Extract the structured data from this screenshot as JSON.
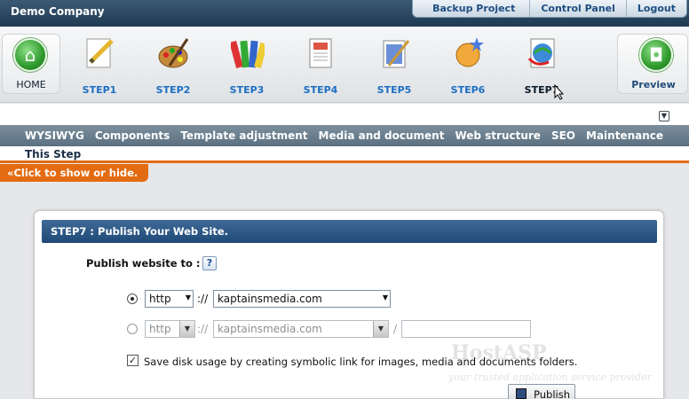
{
  "header": {
    "brand": "Demo Company",
    "links": [
      "Backup Project",
      "Control Panel",
      "Logout"
    ]
  },
  "steps": {
    "home_label": "HOME",
    "preview_label": "Preview",
    "items": [
      "STEP1",
      "STEP2",
      "STEP3",
      "STEP4",
      "STEP5",
      "STEP6",
      "STEP7"
    ],
    "active_index": 6
  },
  "menu": {
    "items": [
      "WYSIWYG",
      "Components",
      "Template adjustment",
      "Media and document",
      "Web structure",
      "SEO",
      "Maintenance"
    ],
    "sub": "This Step",
    "toggle": "Click to show or hide."
  },
  "panel": {
    "title": "STEP7 : Publish Your Web Site.",
    "publish_to_label": "Publish website to :",
    "help": "?",
    "row1": {
      "protocol": "http",
      "sep": "://",
      "domain": "kaptainsmedia.com"
    },
    "row2": {
      "protocol": "http",
      "sep": "://",
      "domain": "kaptainsmedia.com",
      "slash": "/",
      "path": ""
    },
    "checkbox_label": "Save disk usage by creating symbolic link for images, media and documents folders.",
    "checkbox_checked": true,
    "publish_button": "Publish"
  },
  "watermark": {
    "brand": "HostASP",
    "tagline": "your trusted application service provider"
  },
  "colors": {
    "accent": "#e36b12",
    "header": "#1f3a53",
    "panel_head": "#2a5585",
    "step_label": "#1d6fc2"
  }
}
